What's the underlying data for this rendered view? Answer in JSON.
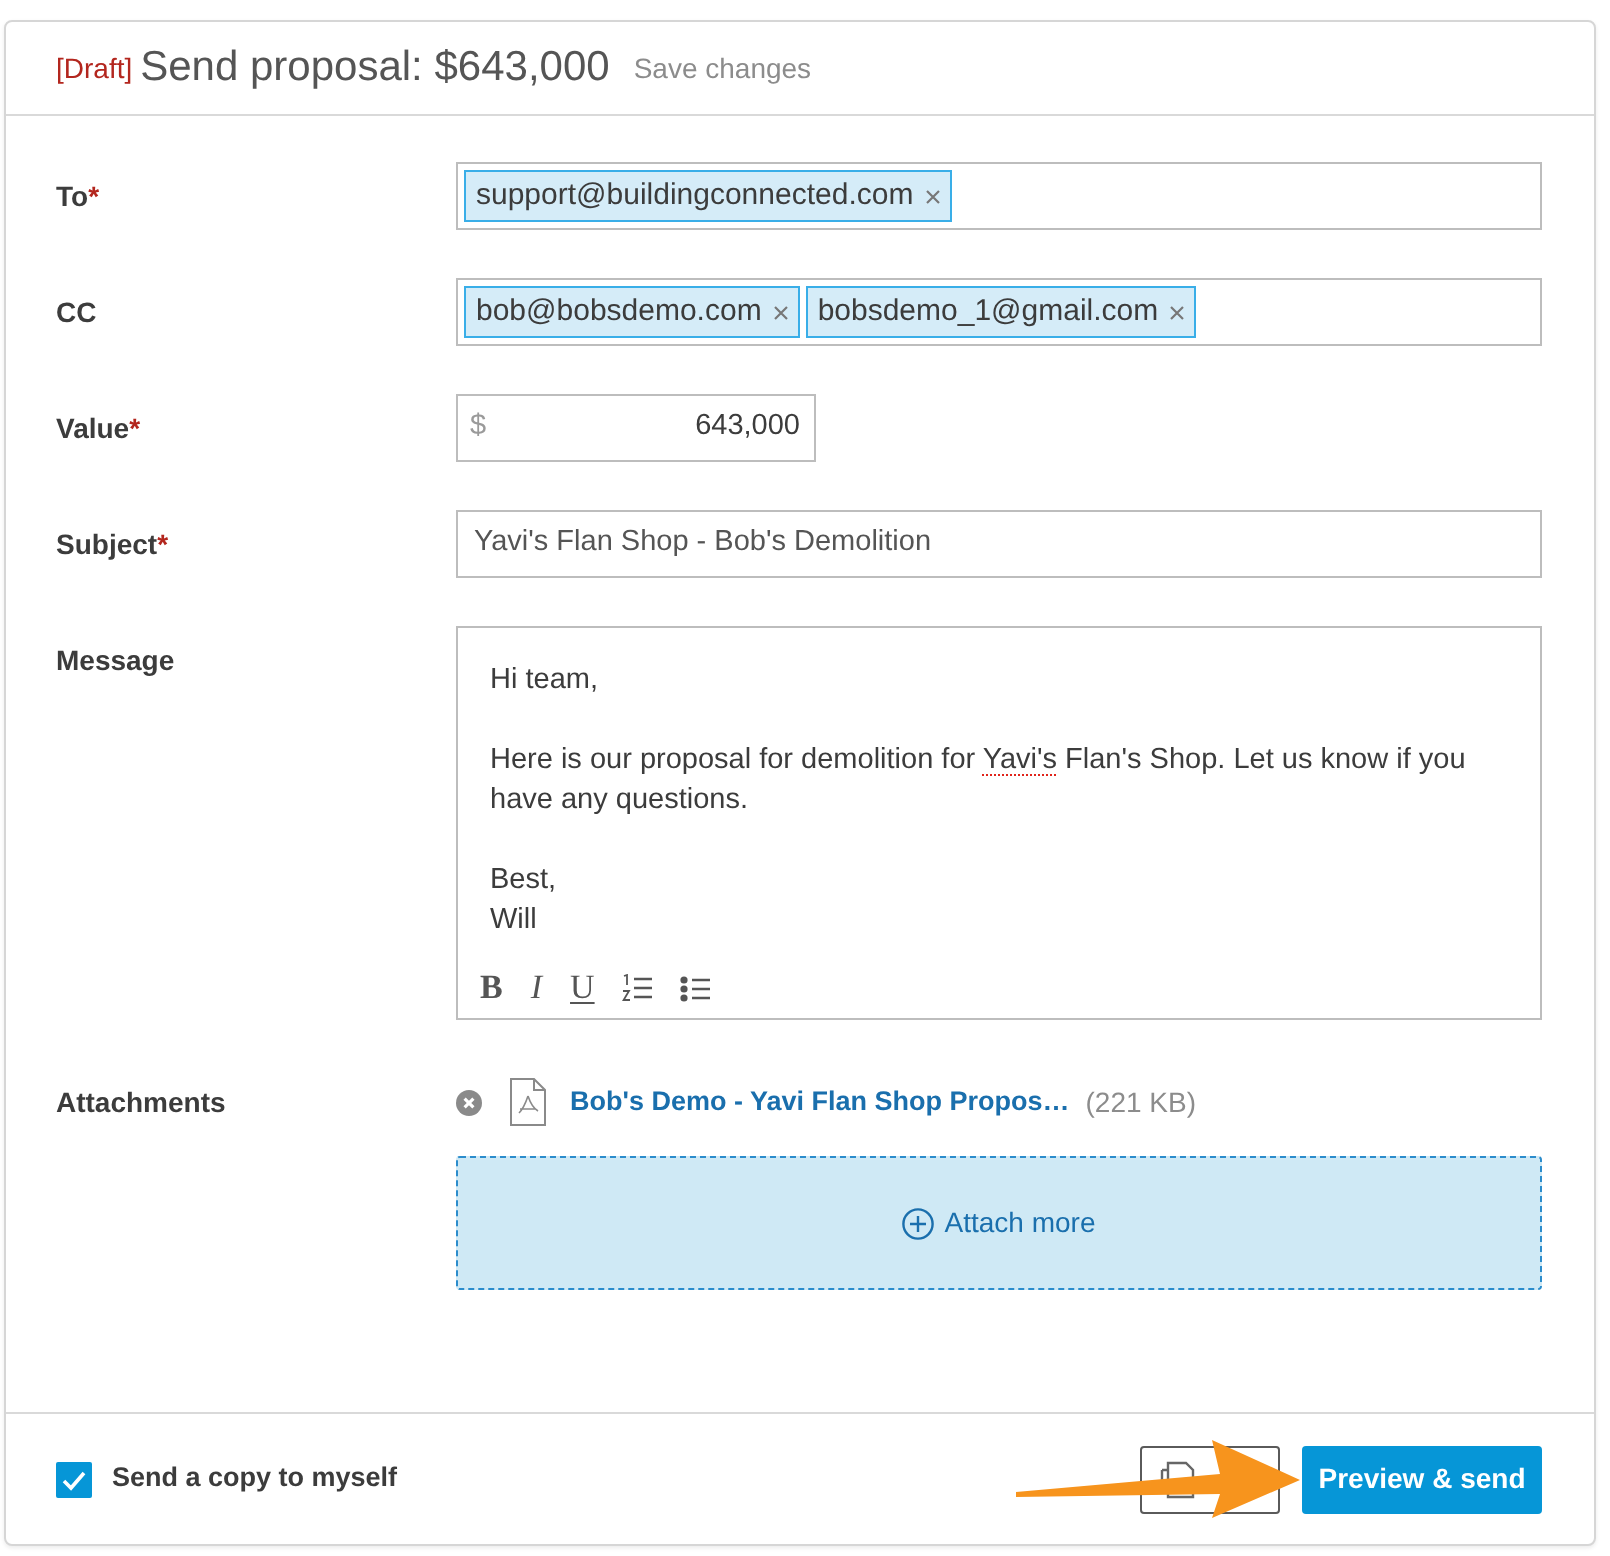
{
  "header": {
    "draft_tag": "[Draft]",
    "title": "Send proposal: $643,000",
    "save_link": "Save changes"
  },
  "fields": [
    {
      "kind": "recipients",
      "label": "To",
      "required_mark": "*",
      "chips": [
        {
          "email": "support@buildingconnected.com"
        }
      ]
    },
    {
      "kind": "recipients",
      "label": "CC",
      "chips": [
        {
          "email": "bob@bobsdemo.com"
        },
        {
          "email": "bobsdemo_1@gmail.com"
        }
      ]
    },
    {
      "kind": "currency",
      "label": "Value",
      "required_mark": "*",
      "prefix": "$",
      "value": "643,000"
    },
    {
      "kind": "text",
      "label": "Subject",
      "required_mark": "*",
      "value": "Yavi's Flan Shop - Bob's Demolition"
    },
    {
      "kind": "message",
      "label": "Message",
      "greeting": "Hi team,",
      "body": [
        {
          "text": "Here is our proposal for demolition for ",
          "misspelled": false
        },
        {
          "text": "Yavi's",
          "misspelled": true
        },
        {
          "text": " Flan's Shop. Let us know if you have any questions.",
          "misspelled": false
        }
      ],
      "closing": "Best,",
      "signature": "Will",
      "toolbar": [
        {
          "kind": "bold",
          "label": "B"
        },
        {
          "kind": "italic",
          "label": "I"
        },
        {
          "kind": "underline",
          "label": "U"
        },
        {
          "kind": "numbered_list"
        },
        {
          "kind": "bulleted_list"
        }
      ]
    },
    {
      "kind": "attachments",
      "label": "Attachments",
      "files": [
        {
          "name": "Bob's Demo - Yavi Flan Shop Propos…",
          "size": "(221 KB)"
        }
      ],
      "attach_more": "Attach more"
    }
  ],
  "footer": {
    "copy_to_self": {
      "label": "Send a copy to myself",
      "checked": true
    },
    "buttons": [
      {
        "kind": "icon"
      },
      {
        "kind": "primary",
        "label": "Preview & send"
      }
    ]
  }
}
